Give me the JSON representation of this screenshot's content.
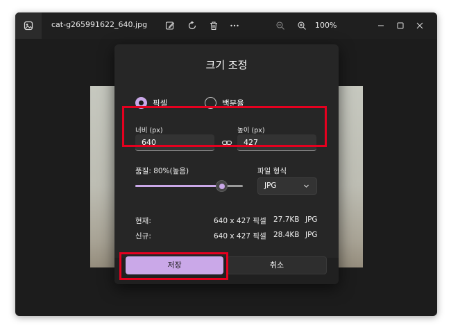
{
  "titlebar": {
    "filename": "cat-g265991622_640.jpg",
    "zoom": "100%",
    "icons": [
      "photo-app-icon",
      "edit-icon",
      "rotate-icon",
      "delete-icon",
      "more-icon",
      "zoom-out-icon",
      "zoom-in-icon",
      "minimize-icon",
      "maximize-icon",
      "close-icon"
    ]
  },
  "dialog": {
    "title": "크기 조정",
    "radio": {
      "pixel_label": "픽셀",
      "percent_label": "백분율",
      "selected": "pixel"
    },
    "width": {
      "label": "너비 (px)",
      "value": "640"
    },
    "height": {
      "label": "높이 (px)",
      "value": "427"
    },
    "quality": {
      "label": "품질: 80%(높음)",
      "value_percent": 80
    },
    "format": {
      "label": "파일 형식",
      "value": "JPG"
    },
    "current": {
      "label": "현재:",
      "dimensions": "640 x 427 픽셀",
      "size": "27.7KB",
      "type": "JPG"
    },
    "new": {
      "label": "신규:",
      "dimensions": "640 x 427 픽셀",
      "size": "28.4KB",
      "type": "JPG"
    },
    "save_label": "저장",
    "cancel_label": "취소"
  },
  "colors": {
    "accent": "#caa8e8",
    "highlight": "#e5001f",
    "dialog_bg": "#262626"
  }
}
